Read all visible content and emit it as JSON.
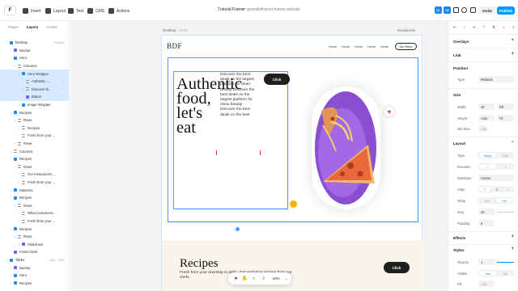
{
  "topbar": {
    "logo": "F",
    "items": [
      {
        "label": "Insert",
        "icon": "plus-square-icon"
      },
      {
        "label": "Layout",
        "icon": "layout-icon"
      },
      {
        "label": "Text",
        "icon": "text-icon"
      },
      {
        "label": "CMS",
        "icon": "database-icon"
      },
      {
        "label": "Actions",
        "icon": "bolt-icon"
      }
    ],
    "project_title": "Tutorial Framer",
    "project_sub": "spondikiframer.framer.website",
    "avatars": [
      "AE",
      "AE"
    ],
    "invite": "Invite",
    "publish": "Publish",
    "accent": "#0099ff"
  },
  "left_panel": {
    "tabs": [
      "Pages",
      "Layers",
      "Assets"
    ],
    "active_tab": "Layers",
    "layers": [
      {
        "label": "Desktop",
        "tag": "Primary",
        "indent": 1,
        "icon": "blue",
        "selected": false
      },
      {
        "label": "Navbar",
        "tag": "",
        "indent": 2,
        "icon": "comp",
        "selected": false
      },
      {
        "label": "Hero",
        "tag": "",
        "indent": 2,
        "icon": "blue",
        "selected": false
      },
      {
        "label": "Columns",
        "tag": "",
        "indent": 3,
        "icon": "lines",
        "selected": false
      },
      {
        "label": "Hero Wrapper",
        "tag": "",
        "indent": 4,
        "icon": "blue",
        "selected": true
      },
      {
        "label": "Authentic ...",
        "tag": "+",
        "indent": 5,
        "icon": "lines",
        "selected": true
      },
      {
        "label": "Discover th...",
        "tag": "+",
        "indent": 5,
        "icon": "lines",
        "selected": true
      },
      {
        "label": "Button",
        "tag": "+",
        "indent": 5,
        "icon": "comp",
        "selected": true
      },
      {
        "label": "Image Wrapper",
        "tag": "",
        "indent": 4,
        "icon": "blue",
        "selected": false
      },
      {
        "label": "Recipes",
        "tag": "",
        "indent": 2,
        "icon": "blue",
        "selected": false
      },
      {
        "label": "Rows",
        "tag": "",
        "indent": 3,
        "icon": "lines",
        "selected": false
      },
      {
        "label": "Recipes",
        "tag": "",
        "indent": 4,
        "icon": "lines",
        "selected": false
      },
      {
        "label": "Fresh from your ...",
        "tag": "",
        "indent": 4,
        "icon": "lines",
        "selected": false
      },
      {
        "label": "Rows",
        "tag": "",
        "indent": 3,
        "icon": "lines",
        "selected": false
      },
      {
        "label": "Columns",
        "tag": "",
        "indent": 2,
        "icon": "lines",
        "selected": false
      },
      {
        "label": "Recipes",
        "tag": "",
        "indent": 2,
        "icon": "blue",
        "selected": false
      },
      {
        "label": "Rows",
        "tag": "",
        "indent": 3,
        "icon": "lines",
        "selected": false
      },
      {
        "label": "Our restaurant's ...",
        "tag": "",
        "indent": 4,
        "icon": "lines",
        "selected": false
      },
      {
        "label": "Fresh from your ...",
        "tag": "",
        "indent": 4,
        "icon": "lines",
        "selected": false
      },
      {
        "label": "Statistics",
        "tag": "",
        "indent": 2,
        "icon": "blue",
        "selected": false
      },
      {
        "label": "Recipes",
        "tag": "",
        "indent": 2,
        "icon": "blue",
        "selected": false
      },
      {
        "label": "Rows",
        "tag": "",
        "indent": 3,
        "icon": "lines",
        "selected": false
      },
      {
        "label": "What Customers...",
        "tag": "",
        "indent": 4,
        "icon": "lines",
        "selected": false
      },
      {
        "label": "Fresh from your ...",
        "tag": "",
        "indent": 4,
        "icon": "lines",
        "selected": false
      },
      {
        "label": "Recipes",
        "tag": "",
        "indent": 2,
        "icon": "blue",
        "selected": false
      },
      {
        "label": "Rows",
        "tag": "",
        "indent": 3,
        "icon": "lines",
        "selected": false
      },
      {
        "label": "Slideshow",
        "tag": "",
        "indent": 4,
        "icon": "comp",
        "selected": false
      },
      {
        "label": "Footer Dark",
        "tag": "",
        "indent": 2,
        "icon": "comp",
        "selected": false
      },
      {
        "label": "Tablet",
        "tag": "640 - 1199",
        "indent": 1,
        "icon": "blue",
        "selected": false
      },
      {
        "label": "Navbar",
        "tag": "",
        "indent": 2,
        "icon": "comp",
        "selected": false
      },
      {
        "label": "Hero",
        "tag": "",
        "indent": 2,
        "icon": "blue",
        "selected": false
      },
      {
        "label": "Recipes",
        "tag": "",
        "indent": 2,
        "icon": "blue",
        "selected": false
      }
    ]
  },
  "canvas": {
    "frame_name": "Desktop",
    "frame_size": "1440",
    "breakpoint": "Breakpoints",
    "nav": {
      "logo": "BDF",
      "links": [
        "Home",
        "Home",
        "Home",
        "Home",
        "Home"
      ],
      "button": "Our Menu"
    },
    "hero": {
      "title": "Authentic food, let's eat",
      "description": "Discover the best deals on the largest platform for clean beauty Discover the best deals on the largest platform for clean beauty Discover the best deals on the best",
      "button": "Click"
    },
    "recipes": {
      "title": "Recipes",
      "description": "Fresh from your doorstep to table. Get exclusive recipes from our chefs.",
      "button": "Click"
    },
    "zoom": "68%"
  },
  "right_panel": {
    "sections": {
      "overlays": "Overlays",
      "link": "Link",
      "position": "Position",
      "size": "Size",
      "layout": "Layout",
      "effects": "Effects",
      "styles": "Styles"
    },
    "position_type_label": "Type",
    "position_type": "Relative",
    "width_label": "Width",
    "width_value": "1fr",
    "width_mode": "Fill",
    "height_label": "Height",
    "height_value": "Auto",
    "height_mode": "Fit",
    "minmax_label": "Min Max",
    "minmax_btn": "Add...",
    "layout_type_label": "Type",
    "layout_type_options": [
      "Stack",
      "Grid"
    ],
    "direction_label": "Direction",
    "distribute_label": "Distribute",
    "distribute_value": "Center",
    "align_label": "Align",
    "wrap_label": "Wrap",
    "wrap_options": [
      "Yes",
      "No"
    ],
    "gap_label": "Gap",
    "gap_value": "32",
    "padding_label": "Padding",
    "padding_value": "0",
    "opacity_label": "Opacity",
    "opacity_value": "1",
    "visible_label": "Visible",
    "visible_options": [
      "Yes",
      "No"
    ],
    "fill_label": "Fill",
    "fill_btn": "Add..."
  }
}
